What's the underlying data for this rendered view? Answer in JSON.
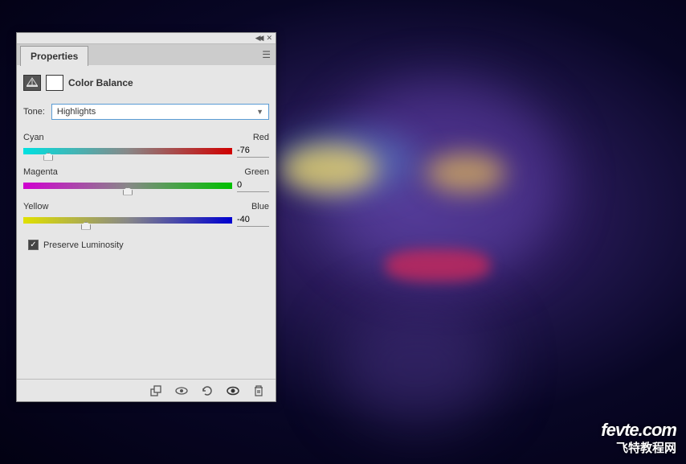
{
  "panel": {
    "tab_label": "Properties",
    "adjustment_name": "Color Balance",
    "tone_label": "Tone:",
    "tone_value": "Highlights",
    "sliders": [
      {
        "left_label": "Cyan",
        "right_label": "Red",
        "value": "-76",
        "position_pct": 12
      },
      {
        "left_label": "Magenta",
        "right_label": "Green",
        "value": "0",
        "position_pct": 50
      },
      {
        "left_label": "Yellow",
        "right_label": "Blue",
        "value": "-40",
        "position_pct": 30
      }
    ],
    "preserve_luminosity_label": "Preserve Luminosity",
    "preserve_luminosity_checked": true
  },
  "watermark": {
    "line1": "fevte.com",
    "line2": "飞特教程网"
  }
}
